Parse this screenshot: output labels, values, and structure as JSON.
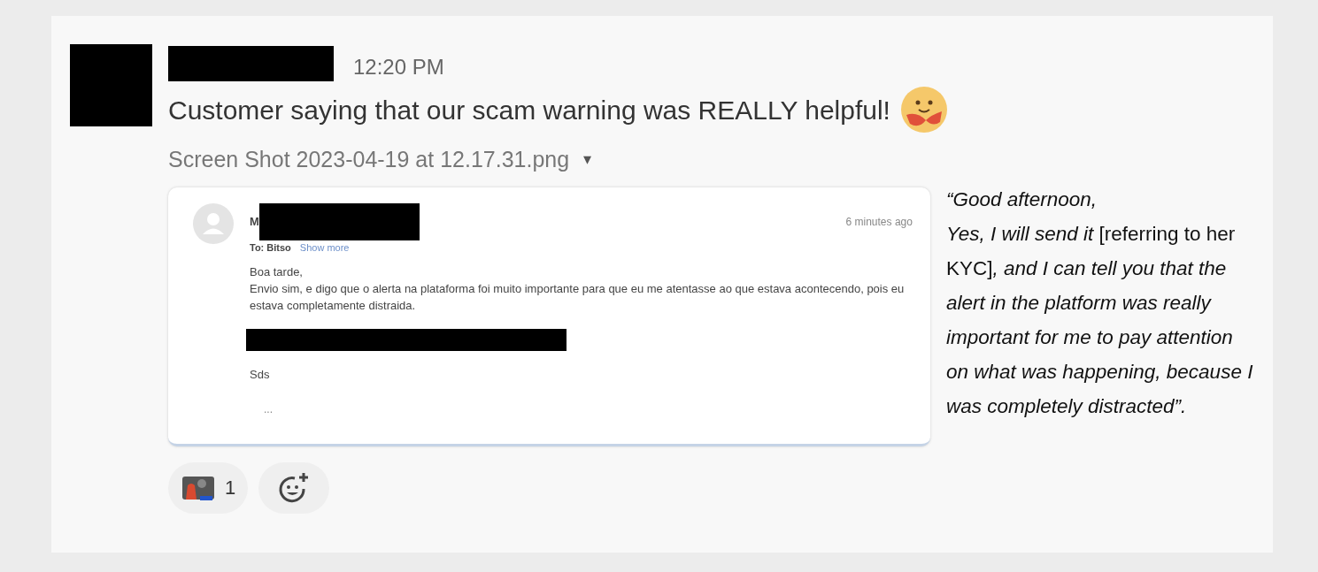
{
  "message": {
    "time": "12:20 PM",
    "text": "Customer saying that our scam warning was REALLY helpful!",
    "attachment": {
      "filename": "Screen Shot 2023-04-19 at 12.17.31.png",
      "caret": "▾"
    }
  },
  "email": {
    "sender_initial": "M",
    "time": "6 minutes ago",
    "to": "To: Bitso",
    "show_more": "Show more",
    "greeting": "Boa tarde,",
    "body": "Envio sim, e digo que o alerta na plataforma foi muito importante para que eu me atentasse ao que estava acontecendo, pois eu estava completamente distraida.",
    "signoff": "Sds",
    "ellipsis": "..."
  },
  "quote": "*“Good afternoon,*\n*Yes, I will send it* [referring to her KYC]*, and I can tell you that the alert in the platform was really important for me to pay attention on what was happening, because I was completely distracted”.*",
  "reactions": [
    {
      "kind": "emoji",
      "count": "1"
    },
    {
      "kind": "add"
    }
  ]
}
